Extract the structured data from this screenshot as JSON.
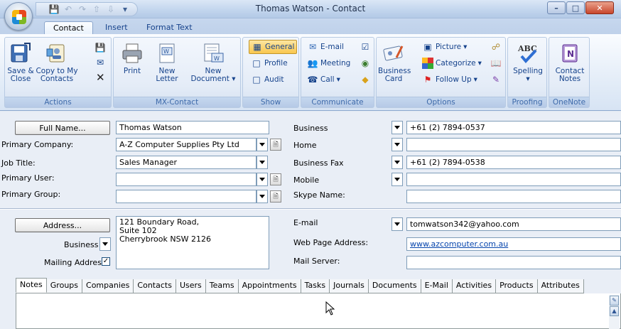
{
  "window": {
    "title": "Thomas Watson - Contact"
  },
  "ribbon_tabs": [
    "Contact",
    "Insert",
    "Format Text"
  ],
  "groups": {
    "actions": {
      "label": "Actions",
      "save_close": [
        "Save &",
        "Close"
      ],
      "copy_to_my_contacts": [
        "Copy to My",
        "Contacts"
      ]
    },
    "mx_contact": {
      "label": "MX-Contact",
      "print": "Print",
      "new_letter": [
        "New",
        "Letter"
      ],
      "new_document": [
        "New",
        "Document"
      ]
    },
    "show": {
      "label": "Show",
      "general": "General",
      "profile": "Profile",
      "audit": "Audit"
    },
    "communicate": {
      "label": "Communicate",
      "email": "E-mail",
      "meeting": "Meeting",
      "call": "Call"
    },
    "options": {
      "label": "Options",
      "business_card": [
        "Business",
        "Card"
      ],
      "picture": "Picture",
      "categorize": "Categorize",
      "follow_up": "Follow Up"
    },
    "proofing": {
      "label": "Proofing",
      "spelling": "Spelling"
    },
    "onenote": {
      "label": "OneNote",
      "contact_notes": [
        "Contact",
        "Notes"
      ]
    }
  },
  "form": {
    "full_name_button": "Full Name...",
    "full_name": "Thomas Watson",
    "primary_company_label": "Primary Company:",
    "primary_company": "A-Z Computer Supplies Pty Ltd",
    "job_title_label": "Job Title:",
    "job_title": "Sales Manager",
    "primary_user_label": "Primary User:",
    "primary_user": "",
    "primary_group_label": "Primary Group:",
    "primary_group": "",
    "phones": [
      {
        "label": "Business",
        "value": "+61 (2) 7894-0537"
      },
      {
        "label": "Home",
        "value": ""
      },
      {
        "label": "Business Fax",
        "value": "+61 (2) 7894-0538"
      },
      {
        "label": "Mobile",
        "value": ""
      }
    ],
    "skype_label": "Skype Name:",
    "skype": "",
    "address_button": "Address...",
    "address_lines": [
      "121 Boundary Road,",
      "Suite 102",
      "Cherrybrook  NSW  2126"
    ],
    "address_type": "Business",
    "mailing_address_label": "Mailing Address",
    "mailing_address_checked": true,
    "email_label": "E-mail",
    "email": "tomwatson342@yahoo.com",
    "web_label": "Web Page Address:",
    "web": "www.azcomputer.com.au",
    "mail_server_label": "Mail Server:",
    "mail_server": ""
  },
  "bottom_tabs": [
    "Notes",
    "Groups",
    "Companies",
    "Contacts",
    "Users",
    "Teams",
    "Appointments",
    "Tasks",
    "Journals",
    "Documents",
    "E-Mail",
    "Activities",
    "Products",
    "Attributes"
  ],
  "colors": {
    "accent": "#15428b",
    "ribbon_bg": "#dbe7f6",
    "active_button": "#f9c74f"
  }
}
